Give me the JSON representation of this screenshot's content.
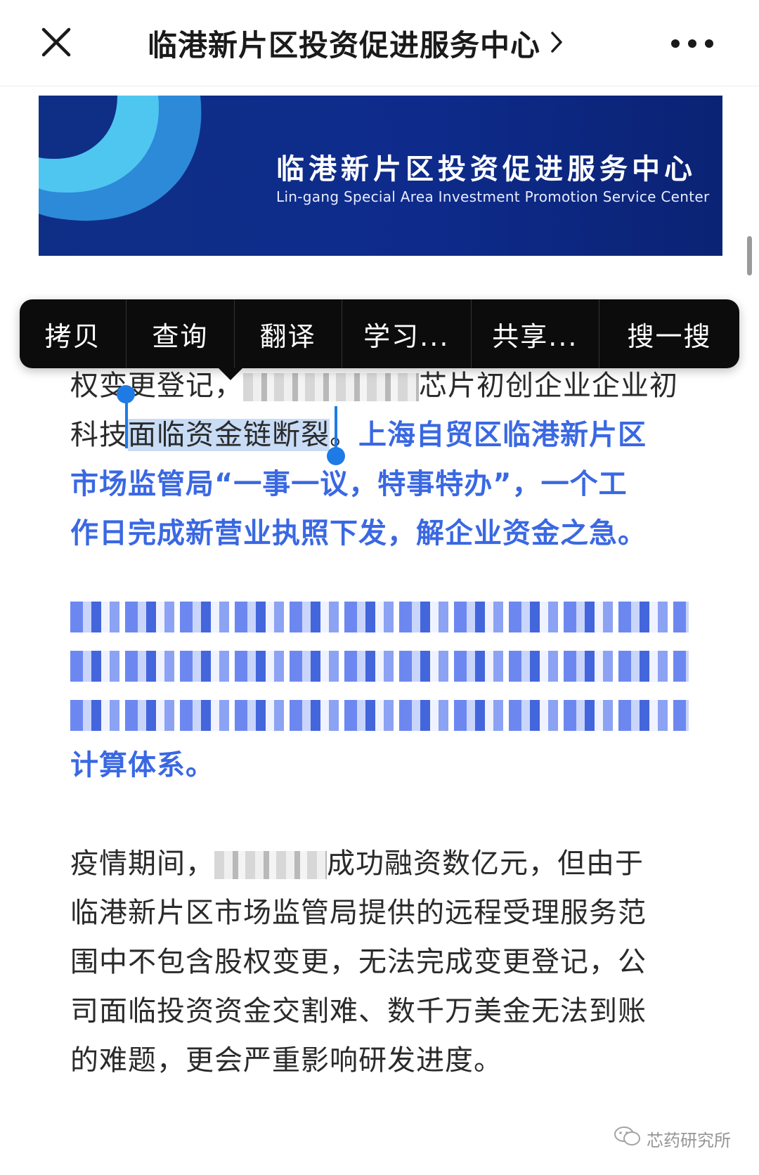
{
  "navbar": {
    "title": "临港新片区投资促进服务中心",
    "title_chevron": "›"
  },
  "banner": {
    "title": "临港新片区投资促进服务中心",
    "subtitle": "Lin-gang Special Area Investment Promotion Service Center"
  },
  "context_menu": {
    "items": [
      "拷贝",
      "查询",
      "翻译",
      "学习...",
      "共享...",
      "搜一搜"
    ]
  },
  "article": {
    "p1_line1_a": "权变更登记，",
    "p1_line1_b": "芯片初创企业企业初",
    "p1_line2_a": "科技",
    "p1_line2_selected": "面临资金链断裂",
    "p1_line2_b": "。",
    "p1_line2_blue": "上海自贸区临港新片区",
    "p1_line3": "市场监管局“一事一议，特事特办”，一个工",
    "p1_line4": "作日完成新营业执照下发，解企业资金之急。",
    "p2_last": "计算体系。",
    "p3_line1_a": "疫情期间，",
    "p3_line1_b": "成功融资数亿元，但由于",
    "p3_line2": "临港新片区市场监管局提供的远程受理服务范",
    "p3_line3": "围中不包含股权变更，无法完成变更登记，公",
    "p3_line4": "司面临投资资金交割难、数千万美金无法到账",
    "p3_line5": "的难题，更会严重影响研发进度。"
  },
  "watermark": {
    "text": "芯药研究所"
  },
  "colors": {
    "accent_blue": "#3a68e3",
    "banner_blue": "#0f2f86",
    "selection": "#c8dcf6",
    "handle": "#1e7be6"
  }
}
